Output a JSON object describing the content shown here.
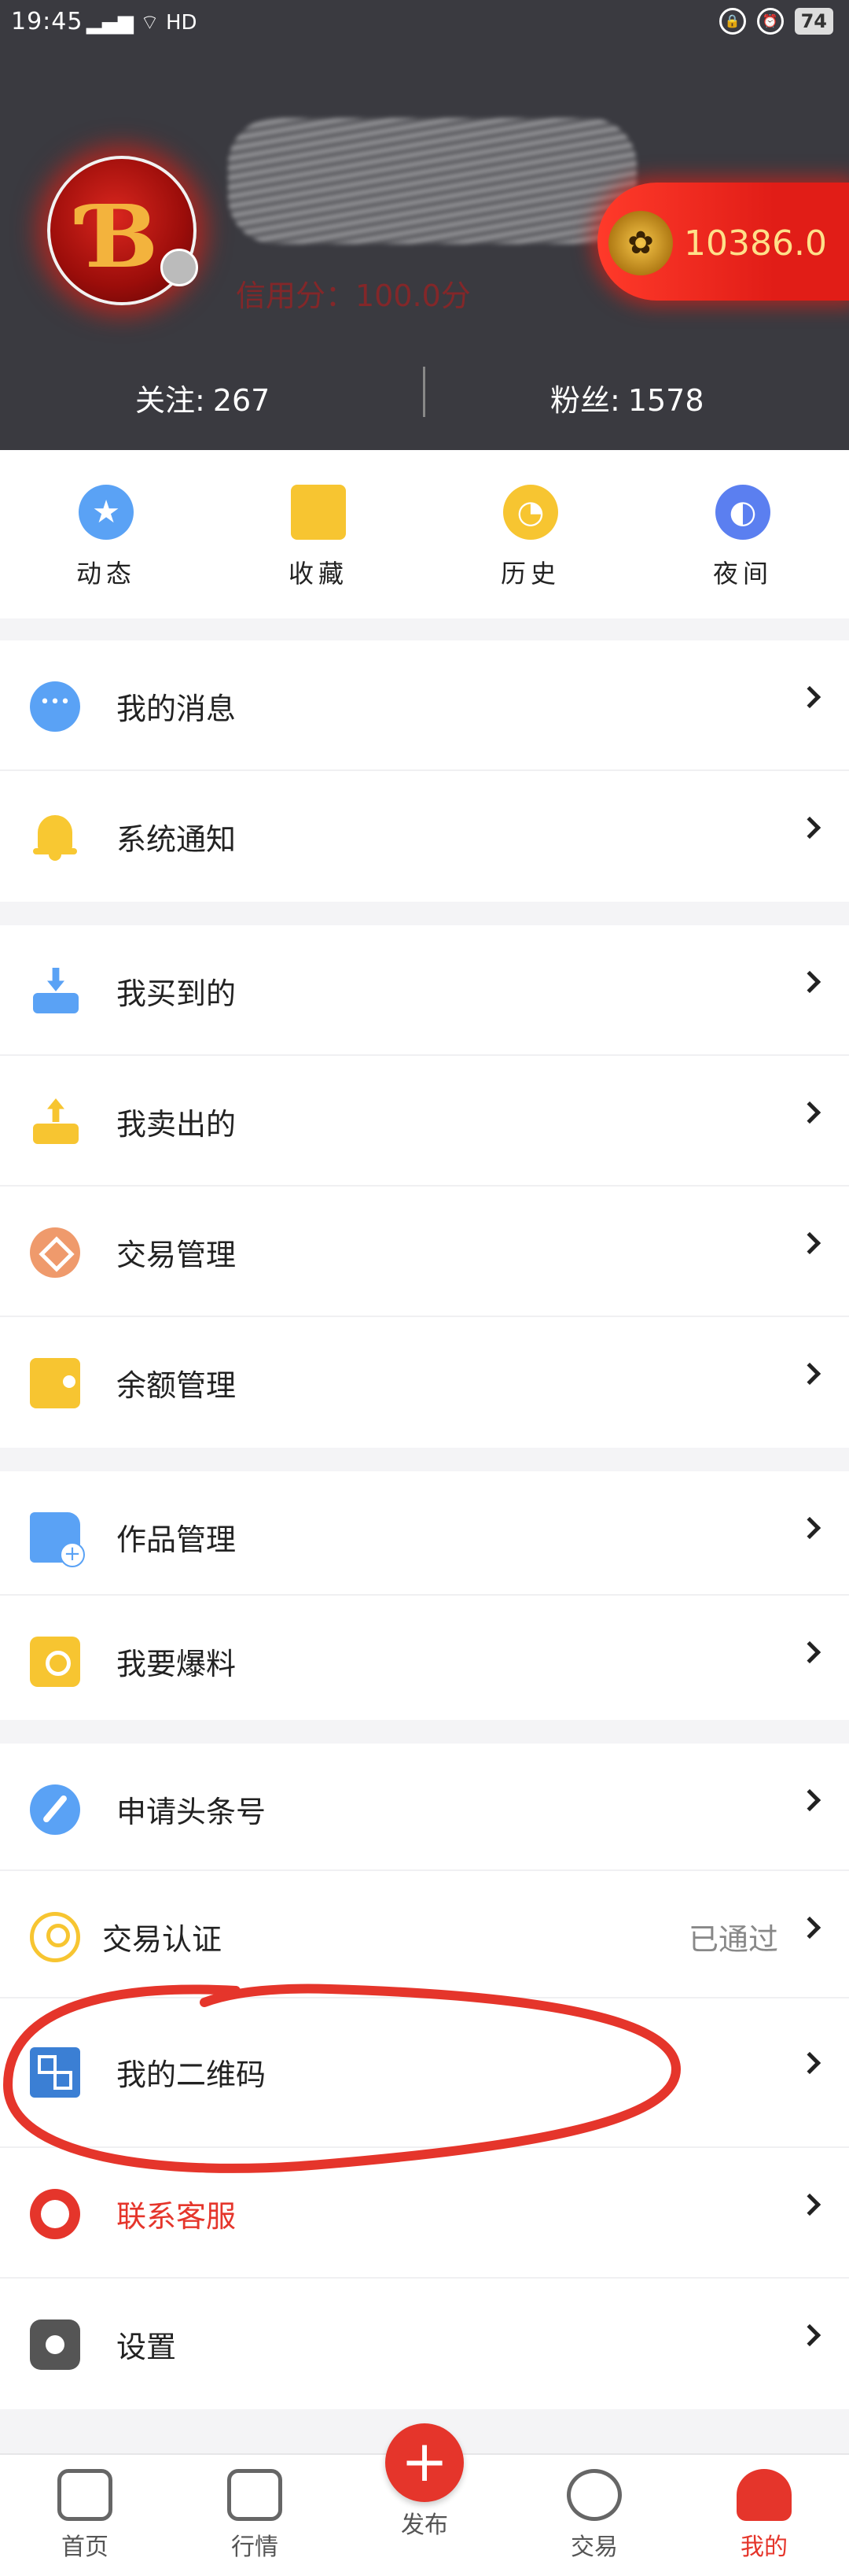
{
  "status_bar": {
    "time": "19:45",
    "signal": "́ıll",
    "battery": "74"
  },
  "profile": {
    "credit_text": "信用分：100.0分",
    "coin_value": "10386.0",
    "following_label": "关注:",
    "following_count": "267",
    "fans_label": "粉丝:",
    "fans_count": "1578"
  },
  "quick_actions": [
    {
      "label": "动态",
      "icon": "star-icon",
      "color": "#5aa2f5"
    },
    {
      "label": "收藏",
      "icon": "box-icon",
      "color": "#f7c531"
    },
    {
      "label": "历史",
      "icon": "clock-icon",
      "color": "#f7c531"
    },
    {
      "label": "夜间",
      "icon": "moon-icon",
      "color": "#5b7ff0"
    }
  ],
  "menu": {
    "messages": "我的消息",
    "notifications": "系统通知",
    "bought": "我买到的",
    "sold": "我卖出的",
    "trade_manage": "交易管理",
    "balance_manage": "余额管理",
    "works_manage": "作品管理",
    "report": "我要爆料",
    "apply_headline": "申请头条号",
    "trade_auth": "交易认证",
    "trade_auth_status": "已通过",
    "qr_code": "我的二维码",
    "customer_service": "联系客服",
    "settings": "设置"
  },
  "tabs": [
    "首页",
    "行情",
    "发布",
    "交易",
    "我的"
  ],
  "colors": {
    "accent": "#e5352b",
    "header_bg": "#3a3a40",
    "blue": "#5aa2f5",
    "yellow": "#f7c531"
  }
}
